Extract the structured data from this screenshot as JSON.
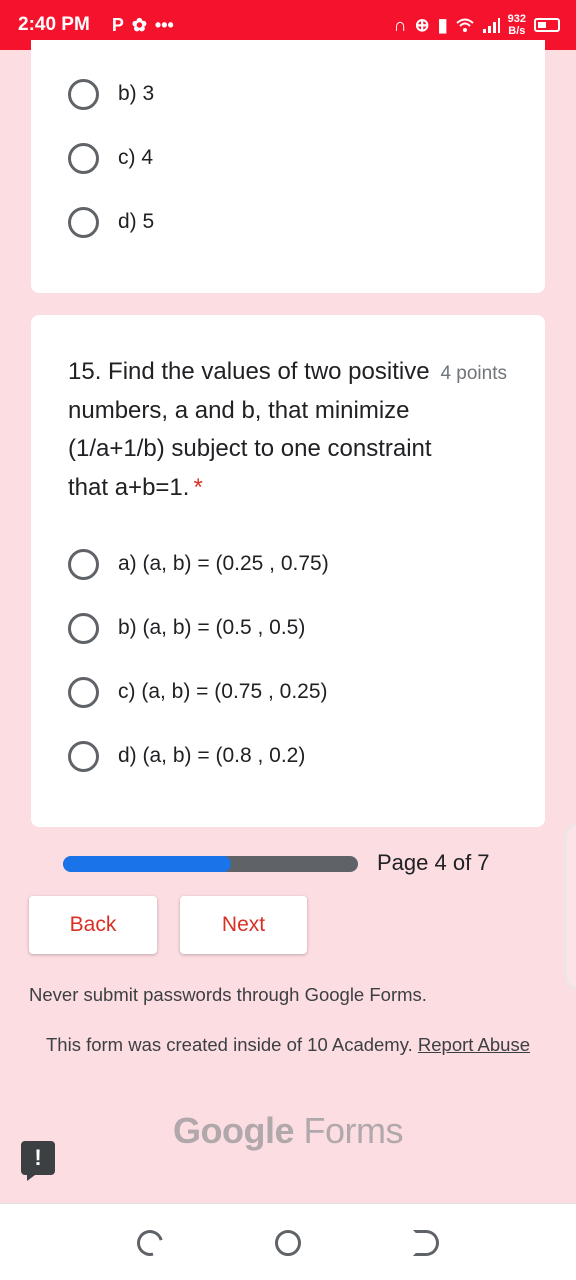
{
  "status_bar": {
    "time": "2:40 PM",
    "left_icons": [
      "parking-icon",
      "gear-icon",
      "more-dots-icon"
    ],
    "net_speed_value": "932",
    "net_speed_unit": "B/s",
    "right_icons": [
      "headphones-icon",
      "data-saver-icon",
      "vibrate-icon",
      "wifi-icon",
      "signal-icon",
      "battery-icon"
    ]
  },
  "previous_question": {
    "options": [
      {
        "label": "b) 3"
      },
      {
        "label": "c) 4"
      },
      {
        "label": "d) 5"
      }
    ]
  },
  "question": {
    "title": "15. Find the values of two positive numbers, a and b, that minimize (1/a+1/b) subject to one constraint that a+b=1.",
    "required_mark": "*",
    "points": "4 points",
    "options": [
      {
        "label": "a) (a, b) = (0.25 , 0.75)"
      },
      {
        "label": "b) (a, b) = (0.5 , 0.5)"
      },
      {
        "label": "c) (a, b) = (0.75 , 0.25)"
      },
      {
        "label": "d) (a, b) = (0.8 , 0.2)"
      }
    ]
  },
  "progress": {
    "label": "Page 4 of 7",
    "fraction": 0.571
  },
  "buttons": {
    "back": "Back",
    "next": "Next"
  },
  "footer": {
    "warning": "Never submit passwords through Google Forms.",
    "created_text": "This form was created inside of 10 Academy.",
    "report_link": "Report Abuse",
    "brand_google": "Google",
    "brand_forms": "Forms"
  },
  "colors": {
    "status_bar": "#f4122d",
    "page_background": "#fcdde2",
    "accent": "#d93025",
    "progress_fill": "#1a73e8",
    "progress_track": "#5f6368"
  },
  "navigation_bar": {
    "icons": [
      "recent-apps-icon",
      "home-icon",
      "back-icon"
    ]
  }
}
